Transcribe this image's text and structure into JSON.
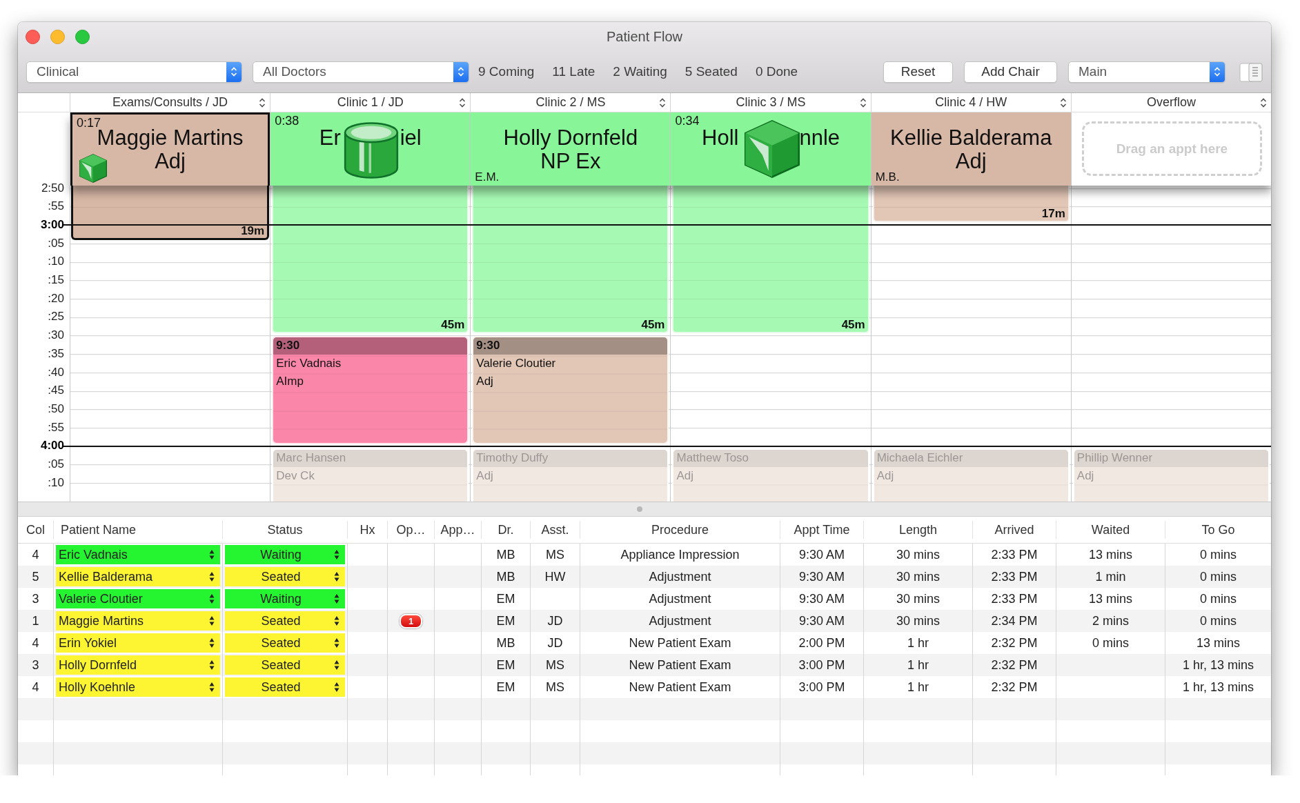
{
  "window": {
    "title": "Patient Flow"
  },
  "toolbar": {
    "view_popup": "Clinical",
    "doctor_popup": "All Doctors",
    "counts": [
      "9 Coming",
      "11 Late",
      "2 Waiting",
      "5 Seated",
      "0 Done"
    ],
    "buttons": [
      "Reset",
      "Add Chair"
    ],
    "location_popup": "Main"
  },
  "schedule": {
    "times": [
      {
        "label": "2:50",
        "hour": false
      },
      {
        "label": ":55",
        "hour": false
      },
      {
        "label": "3:00",
        "hour": true
      },
      {
        "label": ":05",
        "hour": false
      },
      {
        "label": ":10",
        "hour": false
      },
      {
        "label": ":15",
        "hour": false
      },
      {
        "label": ":20",
        "hour": false
      },
      {
        "label": ":25",
        "hour": false
      },
      {
        "label": ":30",
        "hour": false
      },
      {
        "label": ":35",
        "hour": false
      },
      {
        "label": ":40",
        "hour": false
      },
      {
        "label": ":45",
        "hour": false
      },
      {
        "label": ":50",
        "hour": false
      },
      {
        "label": ":55",
        "hour": false
      },
      {
        "label": "4:00",
        "hour": true
      },
      {
        "label": ":05",
        "hour": false
      },
      {
        "label": ":10",
        "hour": false
      }
    ],
    "columns": [
      {
        "title": "Exams/Consults / JD",
        "pinned": {
          "kind": "patient",
          "selected": true,
          "color": "#d7b7a5",
          "elapsed": "0:17",
          "name": "Maggie Martins",
          "procedure": "Adj"
        },
        "appointments": [
          {
            "kind": "tail",
            "selected": true,
            "color": "#d7b7a5",
            "duration": "19m"
          }
        ]
      },
      {
        "title": "Clinic 1 / JD",
        "pinned": {
          "kind": "patient",
          "selected": false,
          "color": "#88f598",
          "elapsed": "0:38",
          "name_parts": [
            "Er",
            "iel"
          ]
        },
        "appointments": [
          {
            "kind": "tail",
            "selected": false,
            "color": "#a6f9b3",
            "duration": "45m"
          },
          {
            "kind": "booked",
            "color": "#fa86a9",
            "time": "9:30",
            "name": "Eric Vadnais",
            "procedure": "AImp"
          },
          {
            "kind": "upcoming",
            "name": "Marc Hansen",
            "procedure": "Dev Ck"
          }
        ]
      },
      {
        "title": "Clinic 2 / MS",
        "pinned": {
          "kind": "patient",
          "selected": false,
          "color": "#88f598",
          "name": "Holly Dornfeld",
          "procedure": "NP Ex",
          "initials": "E.M."
        },
        "appointments": [
          {
            "kind": "tail",
            "selected": false,
            "color": "#a6f9b3",
            "duration": "45m"
          },
          {
            "kind": "booked",
            "color": "#e2c6b6",
            "time": "9:30",
            "name": "Valerie Cloutier",
            "procedure": "Adj"
          },
          {
            "kind": "upcoming",
            "name": "Timothy Duffy",
            "procedure": "Adj"
          }
        ]
      },
      {
        "title": "Clinic 3 / MS",
        "pinned": {
          "kind": "patient",
          "selected": false,
          "color": "#88f598",
          "elapsed": "0:34",
          "name_parts": [
            "Holl",
            "nnle"
          ]
        },
        "appointments": [
          {
            "kind": "tail",
            "selected": false,
            "color": "#a6f9b3",
            "duration": "45m"
          },
          {
            "kind": "upcoming",
            "name": "Matthew Toso",
            "procedure": "Adj"
          }
        ]
      },
      {
        "title": "Clinic 4 / HW",
        "pinned": {
          "kind": "patient",
          "selected": false,
          "color": "#d7b7a5",
          "name": "Kellie Balderama",
          "procedure": "Adj",
          "initials": "M.B."
        },
        "appointments": [
          {
            "kind": "tail",
            "selected": false,
            "color": "#e2c6b6",
            "duration": "17m"
          },
          {
            "kind": "upcoming",
            "name": "Michaela Eichler",
            "procedure": "Adj"
          }
        ]
      },
      {
        "title": "Overflow",
        "pinned": {
          "kind": "dropzone",
          "text": "Drag an appt here"
        },
        "appointments": [
          {
            "kind": "upcoming",
            "name": "Phillip Wenner",
            "procedure": "Adj"
          }
        ]
      }
    ]
  },
  "table": {
    "columns": [
      "Col",
      "Patient Name",
      "Status",
      "Hx",
      "Op…",
      "App…",
      "Dr.",
      "Asst.",
      "Procedure",
      "Appt Time",
      "Length",
      "Arrived",
      "Waited",
      "To Go"
    ],
    "rows": [
      {
        "col": "4",
        "patient_name": "Eric Vadnais",
        "status": "Waiting",
        "color": "#25f530",
        "dr": "MB",
        "asst": "MS",
        "procedure": "Appliance Impression",
        "appt_time": "9:30 AM",
        "length": "30 mins",
        "arrived": "2:33 PM",
        "waited": "13 mins",
        "to_go": "0 mins"
      },
      {
        "col": "5",
        "patient_name": "Kellie Balderama",
        "status": "Seated",
        "color": "#fdf532",
        "dr": "MB",
        "asst": "HW",
        "procedure": "Adjustment",
        "appt_time": "9:30 AM",
        "length": "30 mins",
        "arrived": "2:33 PM",
        "waited": "1 min",
        "to_go": "0 mins"
      },
      {
        "col": "3",
        "patient_name": "Valerie Cloutier",
        "status": "Waiting",
        "color": "#25f530",
        "dr": "EM",
        "procedure": "Adjustment",
        "appt_time": "9:30 AM",
        "length": "30 mins",
        "arrived": "2:33 PM",
        "waited": "13 mins",
        "to_go": "0 mins"
      },
      {
        "col": "1",
        "patient_name": "Maggie Martins",
        "status": "Seated",
        "color": "#fdf532",
        "op_badge": "1",
        "dr": "EM",
        "asst": "JD",
        "procedure": "Adjustment",
        "appt_time": "9:30 AM",
        "length": "30 mins",
        "arrived": "2:34 PM",
        "waited": "2 mins",
        "to_go": "0 mins"
      },
      {
        "col": "4",
        "patient_name": "Erin Yokiel",
        "status": "Seated",
        "color": "#fdf532",
        "dr": "MB",
        "asst": "JD",
        "procedure": "New Patient Exam",
        "appt_time": "2:00 PM",
        "length": "1 hr",
        "arrived": "2:32 PM",
        "waited": "0 mins",
        "to_go": "13 mins"
      },
      {
        "col": "3",
        "patient_name": "Holly Dornfeld",
        "status": "Seated",
        "color": "#fdf532",
        "dr": "EM",
        "asst": "MS",
        "procedure": "New Patient Exam",
        "appt_time": "3:00 PM",
        "length": "1 hr",
        "arrived": "2:32 PM",
        "to_go": "1 hr, 13 mins"
      },
      {
        "col": "4",
        "patient_name": "Holly Koehnle",
        "status": "Seated",
        "color": "#fdf532",
        "dr": "EM",
        "asst": "MS",
        "procedure": "New Patient Exam",
        "appt_time": "3:00 PM",
        "length": "1 hr",
        "arrived": "2:32 PM",
        "to_go": "1 hr, 13 mins"
      }
    ]
  }
}
